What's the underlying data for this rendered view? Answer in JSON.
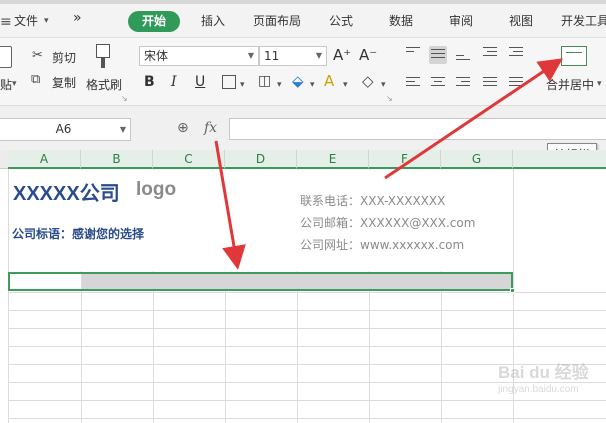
{
  "menubar": {
    "file_label": "文件",
    "more_label": "»",
    "tabs": [
      {
        "label": "开始",
        "active": true
      },
      {
        "label": "插入"
      },
      {
        "label": "页面布局"
      },
      {
        "label": "公式"
      },
      {
        "label": "数据"
      },
      {
        "label": "审阅"
      },
      {
        "label": "视图"
      },
      {
        "label": "开发工具"
      }
    ]
  },
  "ribbon": {
    "paste_label": "贴",
    "cut_label": "剪切",
    "copy_label": "复制",
    "format_painter_label": "格式刷",
    "font_name": "宋体",
    "font_size": "11",
    "bold_label": "B",
    "italic_label": "I",
    "underline_label": "U",
    "grow_font_label": "A⁺",
    "shrink_font_label": "A⁻",
    "merge_label": "合并居中"
  },
  "formula_bar": {
    "name_box": "A6",
    "fx_label": "fx",
    "tooltip": "编辑栏"
  },
  "sheet": {
    "columns": [
      "A",
      "B",
      "C",
      "D",
      "E",
      "F",
      "G"
    ],
    "company_name": "XXXXX公司",
    "logo_text": "logo",
    "slogan": "公司标语：感谢您的选择",
    "phone": "联系电话：XXX-XXXXXXX",
    "email": "公司邮箱：XXXXXX@XXX.com",
    "address": "公司网址：www.xxxxxx.com"
  },
  "watermark": {
    "brand": "Bai du 经验",
    "url": "jingyan.baidu.com"
  },
  "colors": {
    "accent_green": "#2f9a5a",
    "arrow_red": "#e0383a",
    "company_blue": "#2b4c8c"
  }
}
